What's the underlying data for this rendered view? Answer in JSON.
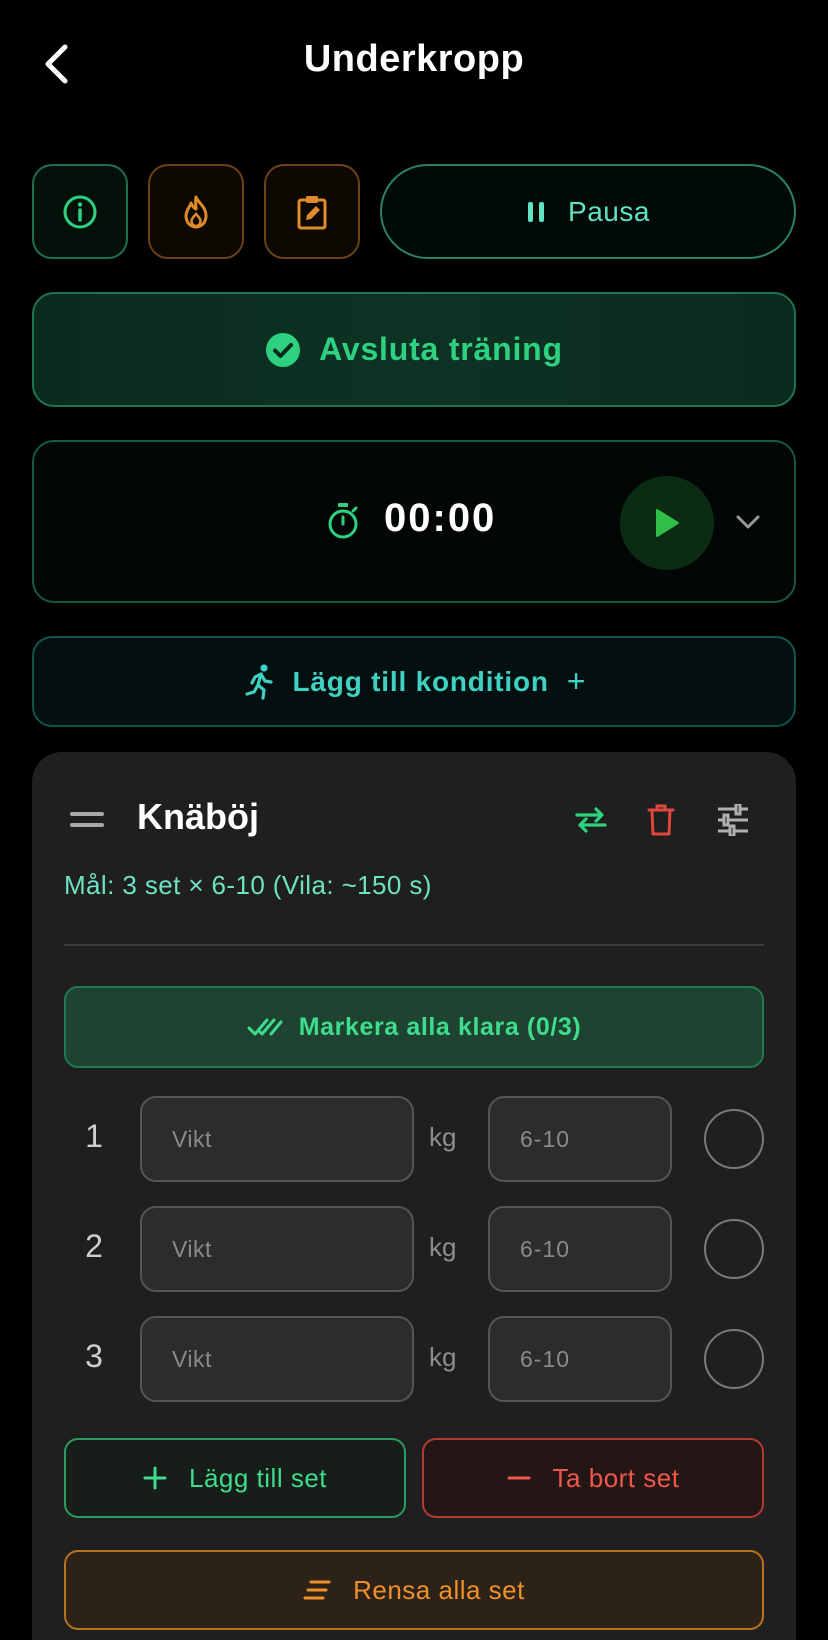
{
  "header": {
    "title": "Underkropp",
    "back_icon": "chevron-left-icon"
  },
  "actions": {
    "info_icon": "info-icon",
    "fire_icon": "flame-icon",
    "note_icon": "clipboard-edit-icon",
    "pause_label": "Pausa",
    "pause_icon": "pause-icon"
  },
  "finish": {
    "label": "Avsluta träning",
    "icon": "check-circle-icon"
  },
  "timer": {
    "value": "00:00",
    "icon": "stopwatch-icon",
    "play_icon": "play-icon",
    "expand_icon": "chevron-down-icon"
  },
  "condition": {
    "label": "Lägg till kondition",
    "plus": "+",
    "icon": "running-person-icon"
  },
  "exercise": {
    "title": "Knäböj",
    "goal": "Mål: 3 set × 6-10 (Vila: ~150 s)",
    "mark_all_label": "Markera alla klara (0/3)",
    "sets": [
      {
        "number": "1",
        "weight_placeholder": "Vikt",
        "unit": "kg",
        "reps_placeholder": "6-10"
      },
      {
        "number": "2",
        "weight_placeholder": "Vikt",
        "unit": "kg",
        "reps_placeholder": "6-10"
      },
      {
        "number": "3",
        "weight_placeholder": "Vikt",
        "unit": "kg",
        "reps_placeholder": "6-10"
      }
    ],
    "add_set_label": "Lägg till set",
    "remove_set_label": "Ta bort set",
    "clear_sets_label": "Rensa alla set"
  },
  "colors": {
    "background": "#000000",
    "accent_green": "#2ed17f",
    "accent_teal": "#5fe3c0",
    "accent_orange": "#e08a2a",
    "danger_red": "#f0574b",
    "card": "#1f1f1f"
  }
}
